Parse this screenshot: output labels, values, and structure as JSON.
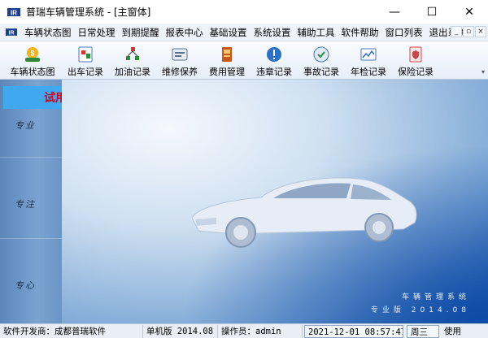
{
  "window": {
    "title": "普瑞车辆管理系统 - [主窗体]",
    "controls": {
      "minimize": "—",
      "maximize": "☐",
      "close": "✕"
    }
  },
  "menu": {
    "items": [
      "车辆状态图",
      "日常处理",
      "到期提醒",
      "报表中心",
      "基础设置",
      "系统设置",
      "辅助工具",
      "软件帮助",
      "窗口列表",
      "退出系统"
    ],
    "mdi_controls": [
      "_",
      "▫",
      "×"
    ]
  },
  "toolbar": {
    "items": [
      {
        "label": "车辆状态图",
        "icon": "vehicle-status-icon"
      },
      {
        "label": "出车记录",
        "icon": "dispatch-record-icon"
      },
      {
        "label": "加油记录",
        "icon": "fuel-record-icon"
      },
      {
        "label": "维修保养",
        "icon": "maintenance-icon"
      },
      {
        "label": "费用管理",
        "icon": "expense-icon"
      },
      {
        "label": "违章记录",
        "icon": "violation-icon"
      },
      {
        "label": "事故记录",
        "icon": "accident-icon"
      },
      {
        "label": "年检记录",
        "icon": "inspection-icon"
      },
      {
        "label": "保险记录",
        "icon": "insurance-icon"
      }
    ]
  },
  "sidebar": {
    "trial_badge": "试用版",
    "labels": [
      "专业",
      "专注",
      "专心"
    ]
  },
  "content": {
    "watermark_lines": [
      "车辆管理系统",
      "专业版 2014.08"
    ]
  },
  "status": {
    "developer": "软件开发商：成都普瑞软件",
    "edition": "单机版 2014.08",
    "operator": "操作员：admin",
    "datetime": "2021-12-01 08:57:47",
    "weekday": "周三",
    "usage": "使用"
  },
  "colors": {
    "accent": "#3fa8ee",
    "trial_text": "#d8001b",
    "sidebar": "#6b95c6",
    "content_dark": "#0d4aa6"
  }
}
